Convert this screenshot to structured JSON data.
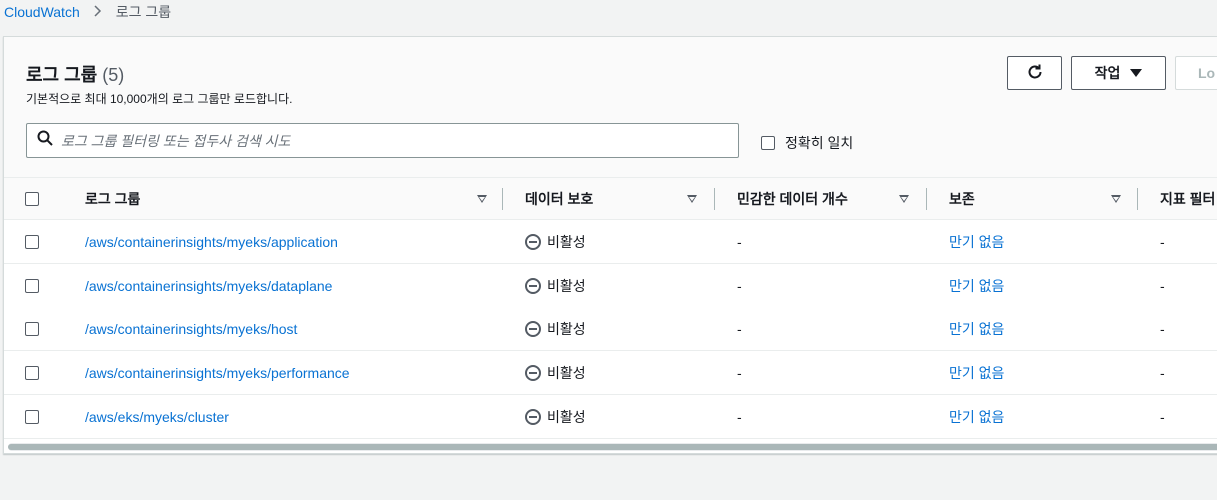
{
  "breadcrumb": {
    "root": "CloudWatch",
    "current": "로그 그룹"
  },
  "header": {
    "title": "로그 그룹",
    "count": "(5)",
    "subtitle": "기본적으로 최대 10,000개의 로그 그룹만 로드합니다."
  },
  "toolbar": {
    "refresh_icon": "refresh-icon",
    "action_label": "작업",
    "log_label": "Lo"
  },
  "search": {
    "placeholder": "로그 그룹 필터링 또는 접두사 검색 시도",
    "exact_match_label": "정확히 일치"
  },
  "table": {
    "columns": [
      "로그 그룹",
      "데이터 보호",
      "민감한 데이터 개수",
      "보존",
      "지표 필터"
    ],
    "rows": [
      {
        "name": "/aws/containerinsights/myeks/application",
        "protection": "비활성",
        "sensitive": "-",
        "retention": "만기 없음",
        "metric": "-"
      },
      {
        "name": "/aws/containerinsights/myeks/dataplane",
        "protection": "비활성",
        "sensitive": "-",
        "retention": "만기 없음",
        "metric": "-"
      },
      {
        "name": "/aws/containerinsights/myeks/host",
        "protection": "비활성",
        "sensitive": "-",
        "retention": "만기 없음",
        "metric": "-"
      },
      {
        "name": "/aws/containerinsights/myeks/performance",
        "protection": "비활성",
        "sensitive": "-",
        "retention": "만기 없음",
        "metric": "-"
      },
      {
        "name": "/aws/eks/myeks/cluster",
        "protection": "비활성",
        "sensitive": "-",
        "retention": "만기 없음",
        "metric": "-"
      }
    ]
  },
  "colors": {
    "link": "#0972d3",
    "text": "#16191f",
    "background": "#f2f3f3"
  }
}
